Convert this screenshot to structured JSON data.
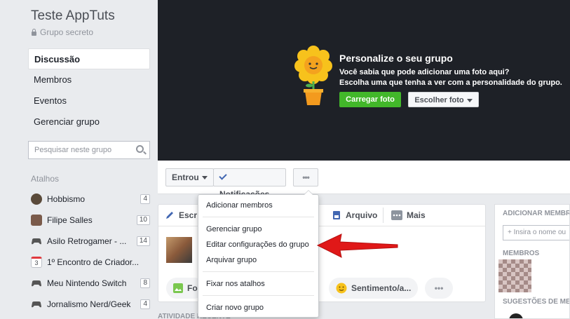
{
  "sidebar": {
    "group_name": "Teste AppTuts",
    "privacy": "Grupo secreto",
    "nav": [
      {
        "label": "Discussão",
        "active": true
      },
      {
        "label": "Membros"
      },
      {
        "label": "Eventos"
      },
      {
        "label": "Gerenciar grupo"
      }
    ],
    "search_placeholder": "Pesquisar neste grupo",
    "shortcuts_title": "Atalhos",
    "shortcuts": [
      {
        "label": "Hobbismo",
        "count": "4",
        "color": "#5a4a3a"
      },
      {
        "label": "Filipe Salles",
        "count": "10",
        "color": "#7a5a4a"
      },
      {
        "label": "Asilo Retrogamer - ...",
        "count": "14",
        "color": "#555"
      },
      {
        "label": "1º Encontro de Criador...",
        "count": "",
        "color": "#e9ebee"
      },
      {
        "label": "Meu Nintendo Switch",
        "count": "8",
        "color": "#555"
      },
      {
        "label": "Jornalismo Nerd/Geek",
        "count": "4",
        "color": "#555"
      }
    ]
  },
  "cover": {
    "title": "Personalize o seu grupo",
    "line1": "Você sabia que pode adicionar uma foto aqui?",
    "line2": "Escolha uma que tenha a ver com a personalidade do grupo.",
    "upload_label": "Carregar foto",
    "choose_label": "Escolher foto",
    "colors": {
      "bg": "#1e2127",
      "green": "#42b72a"
    }
  },
  "actions": {
    "joined_label": "Entrou",
    "notifications_label": "Notificações",
    "more_label": "•••"
  },
  "composer": {
    "write_label": "Escr",
    "file_label": "Arquivo",
    "more_label": "Mais",
    "photo_pill": "Fo",
    "feeling_pill": "Sentimento/a...",
    "dots_pill": "•••"
  },
  "activity_label": "ATIVIDADE RECENTE",
  "right_panel": {
    "add_members_title": "ADICIONAR MEMBROS",
    "add_placeholder": "+ Insira o nome ou",
    "members_title": "MEMBROS",
    "suggestions_title": "SUGESTÕES DE ME"
  },
  "menu": {
    "items": [
      "Adicionar membros",
      "Gerenciar grupo",
      "Editar configurações do grupo",
      "Arquivar grupo",
      "Fixar nos atalhos",
      "Criar novo grupo"
    ]
  }
}
